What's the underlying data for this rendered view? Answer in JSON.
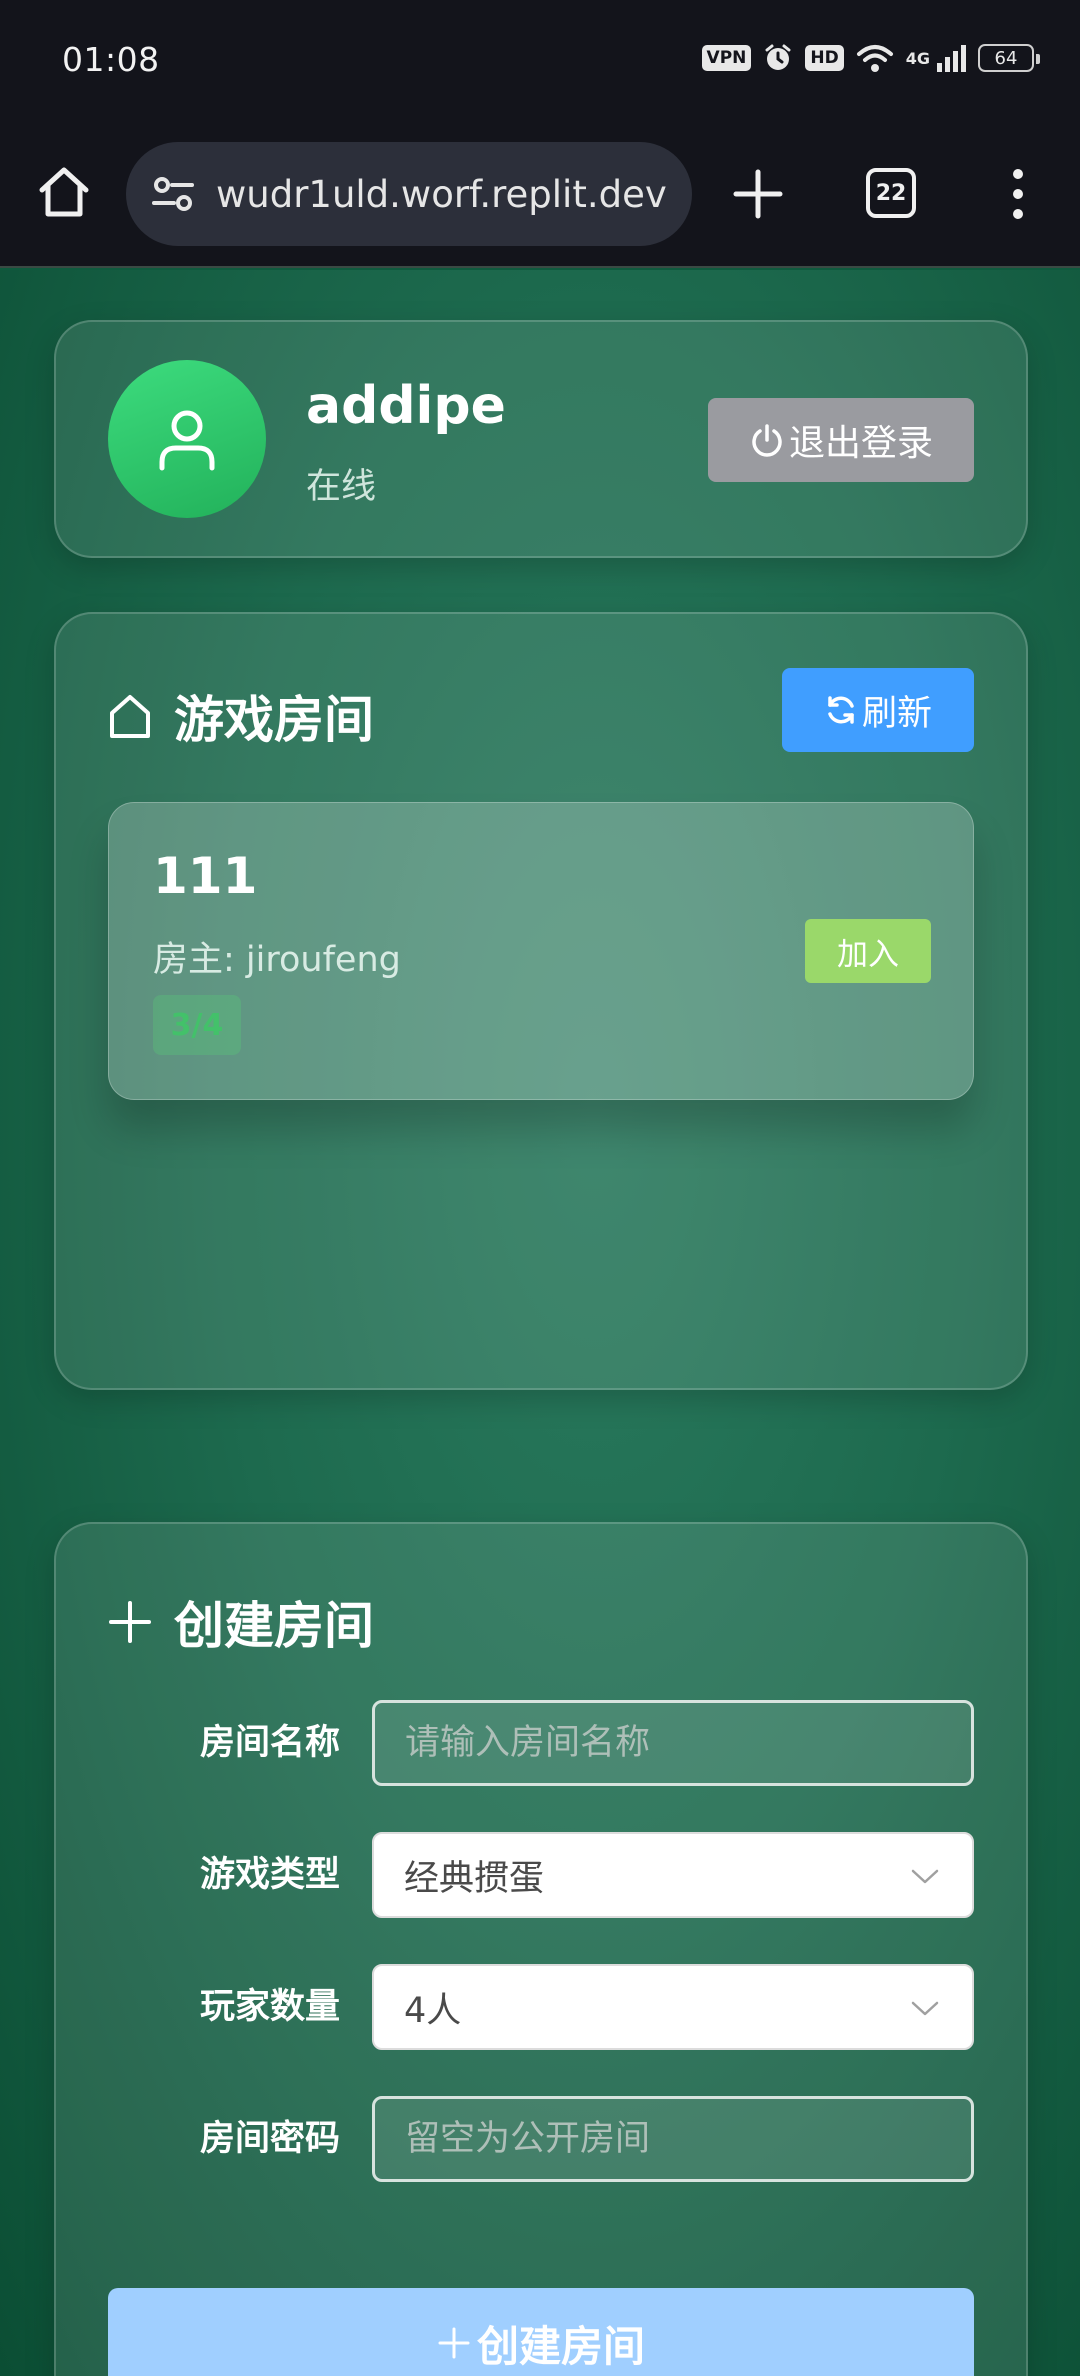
{
  "status_bar": {
    "time": "01:08",
    "vpn_label": "VPN",
    "hd_label": "HD",
    "network_label": "4G",
    "battery_level": "64"
  },
  "browser": {
    "url": "wudr1uld.worf.replit.dev",
    "tab_count": "22"
  },
  "user": {
    "username": "addipe",
    "status": "在线",
    "logout_label": "退出登录"
  },
  "rooms": {
    "title": "游戏房间",
    "refresh_label": "刷新",
    "items": [
      {
        "name": "111",
        "owner": "房主: jiroufeng",
        "players": "3/4",
        "join_label": "加入"
      }
    ]
  },
  "create_room": {
    "title": "创建房间",
    "name_label": "房间名称",
    "name_placeholder": "请输入房间名称",
    "type_label": "游戏类型",
    "type_value": "经典掼蛋",
    "players_label": "玩家数量",
    "players_value": "4人",
    "password_label": "房间密码",
    "password_placeholder": "留空为公开房间",
    "submit_label": "创建房间"
  },
  "colors": {
    "primary_blue": "#409eff",
    "join_green": "#9ad86a",
    "avatar_green": "#2ecc71",
    "submit_disabled_blue": "#a0cfff"
  }
}
